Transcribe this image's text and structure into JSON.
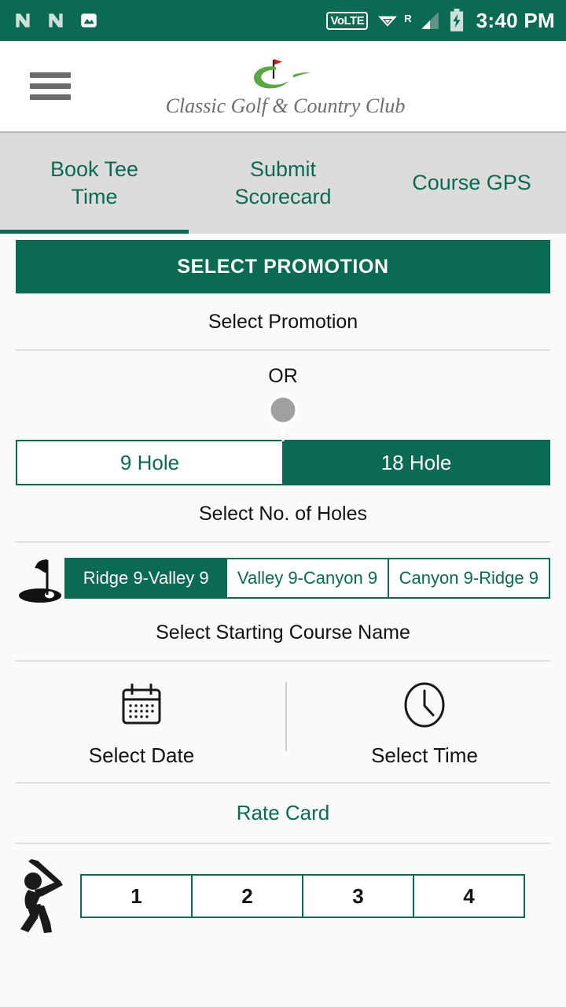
{
  "statusbar": {
    "icons": [
      "news-notification-icon",
      "news-notification-icon",
      "photo-notification-icon"
    ],
    "volte_label": "VoLTE",
    "roaming_label": "R",
    "wifi": "wifi-icon",
    "signal": "signal-bars-icon",
    "battery": "battery-charging-icon",
    "time": "3:40 PM"
  },
  "header": {
    "menu_icon": "hamburger-menu-icon",
    "logo_name": "Classic Golf & Country Club"
  },
  "tabs": [
    {
      "label": "Book Tee\nTime",
      "line1": "Book Tee",
      "line2": "Time",
      "active": true
    },
    {
      "label": "Submit\nScorecard",
      "line1": "Submit",
      "line2": "Scorecard",
      "active": false
    },
    {
      "label": "Course GPS",
      "line1": "Course GPS",
      "line2": "",
      "active": false
    }
  ],
  "main": {
    "promotion_button": "SELECT PROMOTION",
    "promotion_caption": "Select Promotion",
    "or_label": "OR",
    "holes": {
      "options": [
        {
          "label": "9 Hole",
          "selected": false
        },
        {
          "label": "18 Hole",
          "selected": true
        }
      ],
      "caption": "Select No. of Holes"
    },
    "course": {
      "options": [
        {
          "label": "Ridge 9-Valley 9",
          "selected": true
        },
        {
          "label": "Valley 9-Canyon 9",
          "selected": false
        },
        {
          "label": "Canyon 9-Ridge 9",
          "selected": false
        }
      ],
      "caption": "Select Starting Course Name"
    },
    "datetime": {
      "date_label": "Select Date",
      "time_label": "Select Time"
    },
    "rate_card_label": "Rate Card",
    "players": {
      "options": [
        {
          "label": "1",
          "selected": false
        },
        {
          "label": "2",
          "selected": false
        },
        {
          "label": "3",
          "selected": false
        },
        {
          "label": "4",
          "selected": false
        }
      ]
    }
  },
  "colors": {
    "primary_green": "#0a6a52",
    "tab_bar_bg": "#dcdcdc",
    "page_bg": "#fafafa",
    "divider": "#e0e0e0",
    "logo_text": "#6e6e6e",
    "golf_ball": "#a0a0a0"
  }
}
